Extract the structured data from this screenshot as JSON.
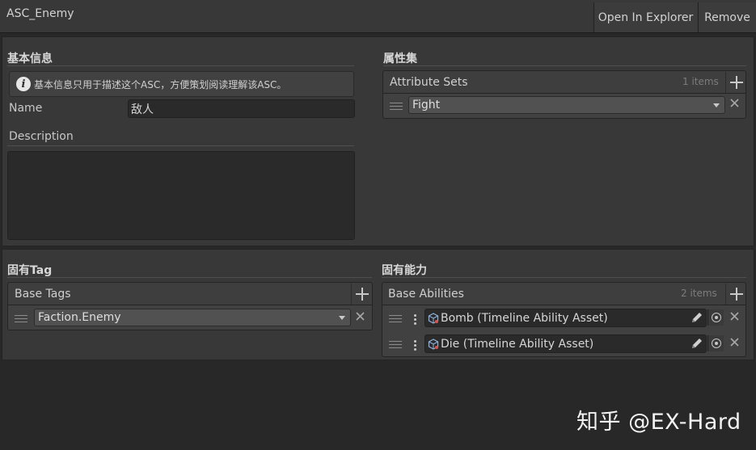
{
  "header": {
    "title": "ASC_Enemy",
    "open_in_explorer": "Open In Explorer",
    "remove": "Remove"
  },
  "basic_info": {
    "section_title": "基本信息",
    "help_text": "基本信息只用于描述这个ASC，方便策划阅读理解该ASC。",
    "name_label": "Name",
    "name_value": "敌人",
    "description_label": "Description",
    "description_value": ""
  },
  "attributes": {
    "section_title": "属性集",
    "list_title": "Attribute Sets",
    "count": "1 items",
    "items": [
      {
        "value": "Fight"
      }
    ]
  },
  "tags": {
    "section_title": "固有Tag",
    "list_title": "Base Tags",
    "items": [
      {
        "value": "Faction.Enemy"
      }
    ]
  },
  "abilities": {
    "section_title": "固有能力",
    "list_title": "Base Abilities",
    "count": "2 items",
    "items": [
      {
        "value": "Bomb (Timeline Ability Asset)"
      },
      {
        "value": "Die (Timeline Ability Asset)"
      }
    ]
  },
  "watermark": "知乎 @EX-Hard",
  "icons": {
    "info": "info-icon",
    "add": "plus-icon",
    "remove": "close-icon",
    "drag": "drag-handle-icon",
    "dropdown": "chevron-down-icon",
    "asset": "asset-cube-icon",
    "edit": "pencil-icon",
    "pick": "object-picker-icon",
    "menu": "vertical-dots-icon"
  }
}
